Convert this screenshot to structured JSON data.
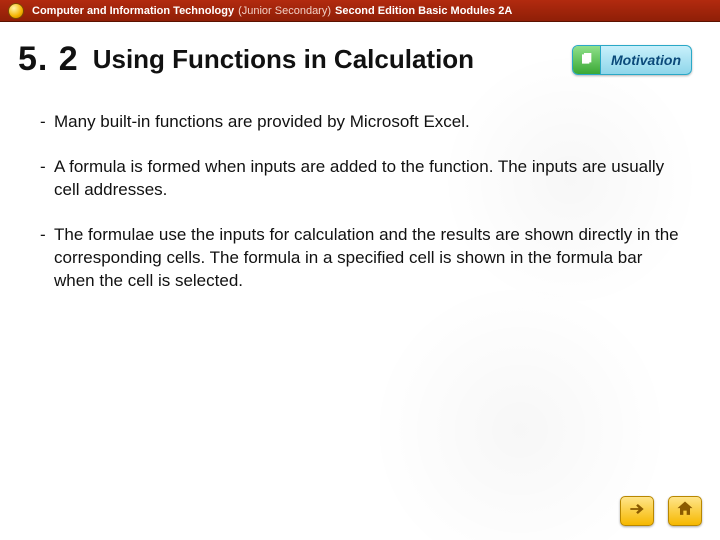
{
  "header": {
    "book_title_bold": "Computer and Information Technology",
    "book_title_light": "(Junior Secondary)",
    "book_title_tail": "Second Edition Basic Modules 2A"
  },
  "section": {
    "number": "5. 2",
    "title": "Using Functions in Calculation"
  },
  "badge": {
    "label": "Motivation",
    "icon": "pages-icon"
  },
  "bullets": [
    "Many built-in functions are provided by Microsoft Excel.",
    "A formula is formed when inputs are added to the function. The inputs are usually cell addresses.",
    "The formulae use the inputs for calculation and the results are shown directly in the corresponding cells. The formula in a specified cell is shown in the formula bar when the cell is selected."
  ],
  "footer": {
    "next_icon": "arrow-right-icon",
    "home_icon": "home-icon"
  }
}
